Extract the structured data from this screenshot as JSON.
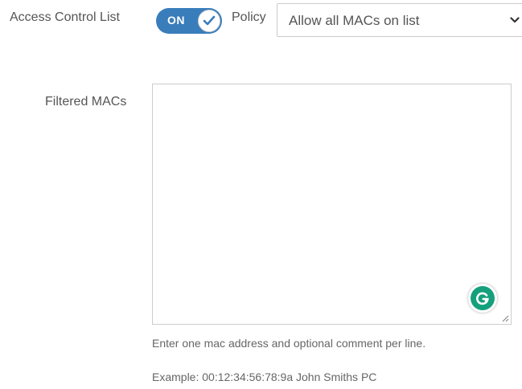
{
  "acl": {
    "label": "Access Control List",
    "toggle_text": "ON",
    "toggle_on": true
  },
  "policy": {
    "label": "Policy",
    "selected": "Allow all MACs on list"
  },
  "filtered": {
    "label": "Filtered MACs",
    "value": ""
  },
  "help": {
    "line1": "Enter one mac address and optional comment per line.",
    "line2": "Example: 00:12:34:56:78:9a John Smiths PC"
  },
  "colors": {
    "toggle_bg": "#3a7dbb",
    "grammarly": "#15a07c"
  },
  "icons": [
    "check-icon",
    "chevron-down-icon",
    "grammarly-icon",
    "resize-handle-icon"
  ]
}
